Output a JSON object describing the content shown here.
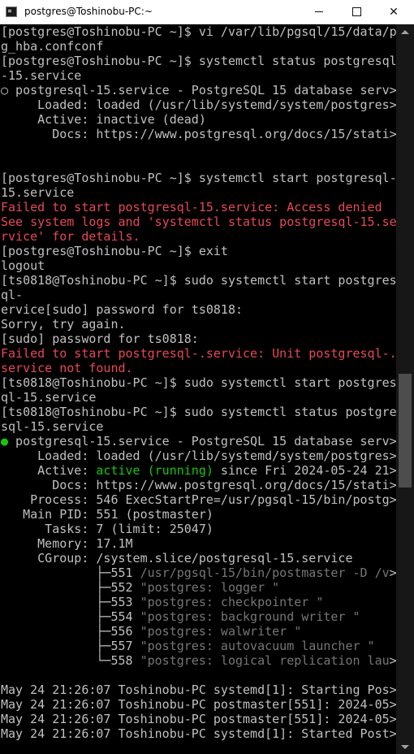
{
  "window": {
    "title": "postgres@Toshinobu-PC:~",
    "minimize_label": "",
    "maximize_label": "",
    "close_label": "✕"
  },
  "terminal": {
    "lines": [
      {
        "segments": [
          {
            "text": "[postgres@Toshinobu-PC ~]$ vi /var/lib/pgsql/15/data/p",
            "style": "normal"
          }
        ]
      },
      {
        "segments": [
          {
            "text": "g_hba.confconf",
            "style": "normal"
          }
        ]
      },
      {
        "segments": [
          {
            "text": "[postgres@Toshinobu-PC ~]$ systemctl status postgresql",
            "style": "normal"
          }
        ]
      },
      {
        "segments": [
          {
            "text": "-15.service",
            "style": "normal"
          }
        ]
      },
      {
        "segments": [
          {
            "text": "○ postgresql-15.service - PostgreSQL 15 database serv>",
            "style": "normal"
          }
        ]
      },
      {
        "segments": [
          {
            "text": "     Loaded: loaded (/usr/lib/systemd/system/postgres>",
            "style": "normal"
          }
        ]
      },
      {
        "segments": [
          {
            "text": "     Active: inactive (dead)",
            "style": "normal"
          }
        ]
      },
      {
        "segments": [
          {
            "text": "       Docs: https://www.postgresql.org/docs/15/stati>",
            "style": "normal"
          }
        ]
      },
      {
        "segments": [
          {
            "text": "",
            "style": "normal"
          }
        ]
      },
      {
        "segments": [
          {
            "text": "",
            "style": "normal"
          }
        ]
      },
      {
        "segments": [
          {
            "text": "[postgres@Toshinobu-PC ~]$ systemctl start postgresql-",
            "style": "normal"
          }
        ]
      },
      {
        "segments": [
          {
            "text": "15.service",
            "style": "normal"
          }
        ]
      },
      {
        "segments": [
          {
            "text": "Failed to start postgresql-15.service: Access denied",
            "style": "red"
          }
        ]
      },
      {
        "segments": [
          {
            "text": "See system logs and 'systemctl status postgresql-15.se",
            "style": "red"
          }
        ]
      },
      {
        "segments": [
          {
            "text": "rvice' for details.",
            "style": "red"
          }
        ]
      },
      {
        "segments": [
          {
            "text": "[postgres@Toshinobu-PC ~]$ exit",
            "style": "normal"
          }
        ]
      },
      {
        "segments": [
          {
            "text": "logout",
            "style": "normal"
          }
        ]
      },
      {
        "segments": [
          {
            "text": "[ts0818@Toshinobu-PC ~]$ sudo systemctl start postgres",
            "style": "normal"
          }
        ]
      },
      {
        "segments": [
          {
            "text": "ql-",
            "style": "normal"
          }
        ]
      },
      {
        "segments": [
          {
            "text": "ervice[sudo] password for ts0818:",
            "style": "normal"
          }
        ]
      },
      {
        "segments": [
          {
            "text": "Sorry, try again.",
            "style": "normal"
          }
        ]
      },
      {
        "segments": [
          {
            "text": "[sudo] password for ts0818:",
            "style": "normal"
          }
        ]
      },
      {
        "segments": [
          {
            "text": "Failed to start postgresql-.service: Unit postgresql-.",
            "style": "red"
          }
        ]
      },
      {
        "segments": [
          {
            "text": "service not found.",
            "style": "red"
          }
        ]
      },
      {
        "segments": [
          {
            "text": "[ts0818@Toshinobu-PC ~]$ sudo systemctl start postgres",
            "style": "normal"
          }
        ]
      },
      {
        "segments": [
          {
            "text": "ql-15.service",
            "style": "normal"
          }
        ]
      },
      {
        "segments": [
          {
            "text": "[ts0818@Toshinobu-PC ~]$ sudo systemctl status postgre",
            "style": "normal"
          }
        ]
      },
      {
        "segments": [
          {
            "text": "sql-15.service",
            "style": "normal"
          }
        ]
      },
      {
        "segments": [
          {
            "text": "●",
            "style": "green"
          },
          {
            "text": " postgresql-15.service - PostgreSQL 15 database serv>",
            "style": "normal"
          }
        ]
      },
      {
        "segments": [
          {
            "text": "     Loaded: loaded (/usr/lib/systemd/system/postgres>",
            "style": "normal"
          }
        ]
      },
      {
        "segments": [
          {
            "text": "     Active: ",
            "style": "normal"
          },
          {
            "text": "active (running)",
            "style": "green"
          },
          {
            "text": " since Fri 2024-05-24 21>",
            "style": "normal"
          }
        ]
      },
      {
        "segments": [
          {
            "text": "       Docs: https://www.postgresql.org/docs/15/stati>",
            "style": "normal"
          }
        ]
      },
      {
        "segments": [
          {
            "text": "    Process: 546 ExecStartPre=/usr/pgsql-15/bin/postg>",
            "style": "normal"
          }
        ]
      },
      {
        "segments": [
          {
            "text": "   Main PID: 551 (postmaster)",
            "style": "normal"
          }
        ]
      },
      {
        "segments": [
          {
            "text": "      Tasks: 7 (limit: 25047)",
            "style": "normal"
          }
        ]
      },
      {
        "segments": [
          {
            "text": "     Memory: 17.1M",
            "style": "normal"
          }
        ]
      },
      {
        "segments": [
          {
            "text": "     CGroup: /system.slice/postgresql-15.service",
            "style": "normal"
          }
        ]
      },
      {
        "segments": [
          {
            "text": "             ├─551 ",
            "style": "normal"
          },
          {
            "text": "/usr/pgsql-15/bin/postmaster -D /v",
            "style": "dim"
          },
          {
            "text": ">",
            "style": "normal"
          }
        ]
      },
      {
        "segments": [
          {
            "text": "             ├─552 ",
            "style": "normal"
          },
          {
            "text": "\"postgres: logger \"",
            "style": "dim"
          }
        ]
      },
      {
        "segments": [
          {
            "text": "             ├─553 ",
            "style": "normal"
          },
          {
            "text": "\"postgres: checkpointer \"",
            "style": "dim"
          }
        ]
      },
      {
        "segments": [
          {
            "text": "             ├─554 ",
            "style": "normal"
          },
          {
            "text": "\"postgres: background writer \"",
            "style": "dim"
          }
        ]
      },
      {
        "segments": [
          {
            "text": "             ├─556 ",
            "style": "normal"
          },
          {
            "text": "\"postgres: walwriter \"",
            "style": "dim"
          }
        ]
      },
      {
        "segments": [
          {
            "text": "             ├─557 ",
            "style": "normal"
          },
          {
            "text": "\"postgres: autovacuum launcher \"",
            "style": "dim"
          }
        ]
      },
      {
        "segments": [
          {
            "text": "             └─558 ",
            "style": "normal"
          },
          {
            "text": "\"postgres: logical replication lau",
            "style": "dim"
          },
          {
            "text": ">",
            "style": "normal"
          }
        ]
      },
      {
        "segments": [
          {
            "text": "",
            "style": "normal"
          }
        ]
      },
      {
        "segments": [
          {
            "text": "May 24 21:26:07 Toshinobu-PC systemd[1]: Starting Pos>",
            "style": "normal"
          }
        ]
      },
      {
        "segments": [
          {
            "text": "May 24 21:26:07 Toshinobu-PC postmaster[551]: 2024-05>",
            "style": "normal"
          }
        ]
      },
      {
        "segments": [
          {
            "text": "May 24 21:26:07 Toshinobu-PC postmaster[551]: 2024-05>",
            "style": "normal"
          }
        ]
      },
      {
        "segments": [
          {
            "text": "May 24 21:26:07 Toshinobu-PC systemd[1]: Started Post>",
            "style": "normal"
          }
        ]
      }
    ]
  },
  "scrollbar": {
    "position_fraction": 0.57
  },
  "colors": {
    "background": "#000000",
    "text": "#c0c0c0",
    "error": "#e74856",
    "success": "#16c60c",
    "dim": "#767676"
  }
}
